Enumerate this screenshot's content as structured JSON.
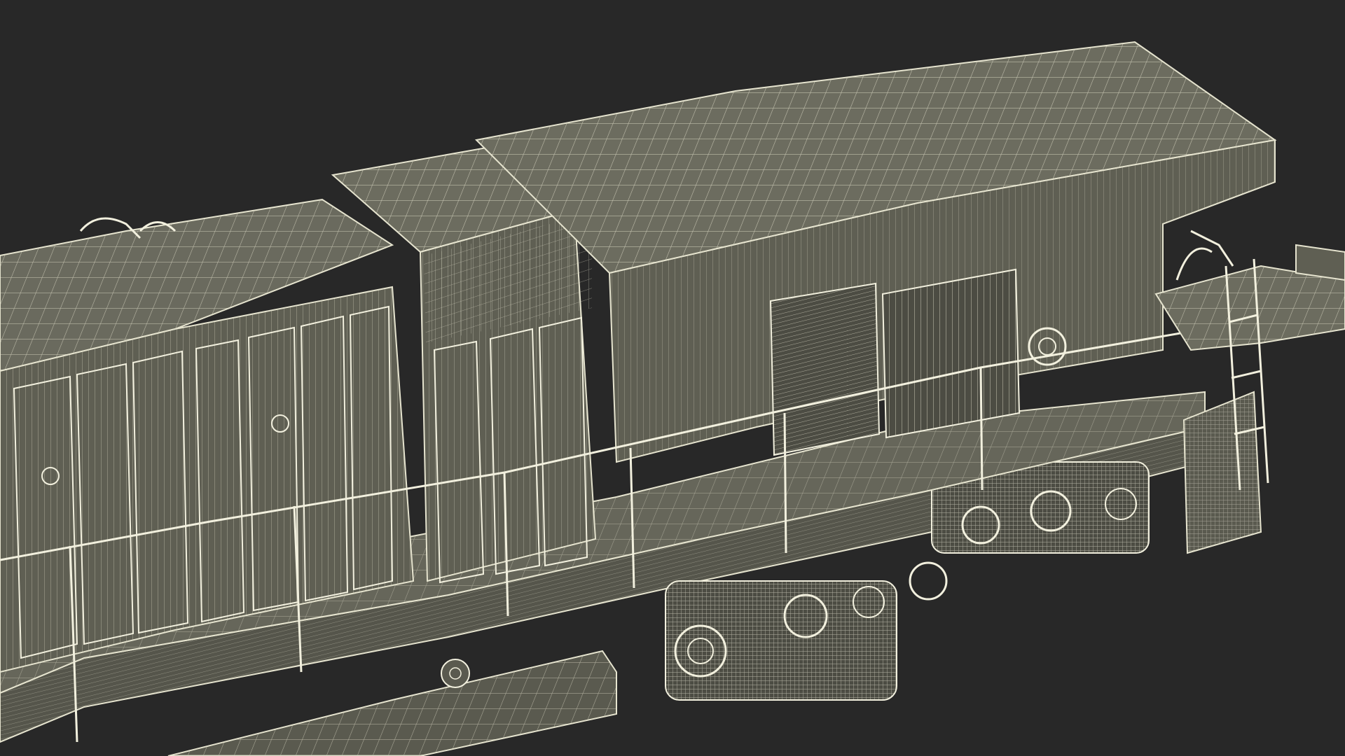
{
  "scene": {
    "subject": "locomotive-wireframe-render",
    "colors": {
      "background": "#282828",
      "body_fill": "#5f5f53",
      "body_fill_light": "#6c6c5f",
      "body_fill_dark": "#4c4c43",
      "wire": "#e6e4cf",
      "wire_dense": "#f2f0de"
    }
  }
}
